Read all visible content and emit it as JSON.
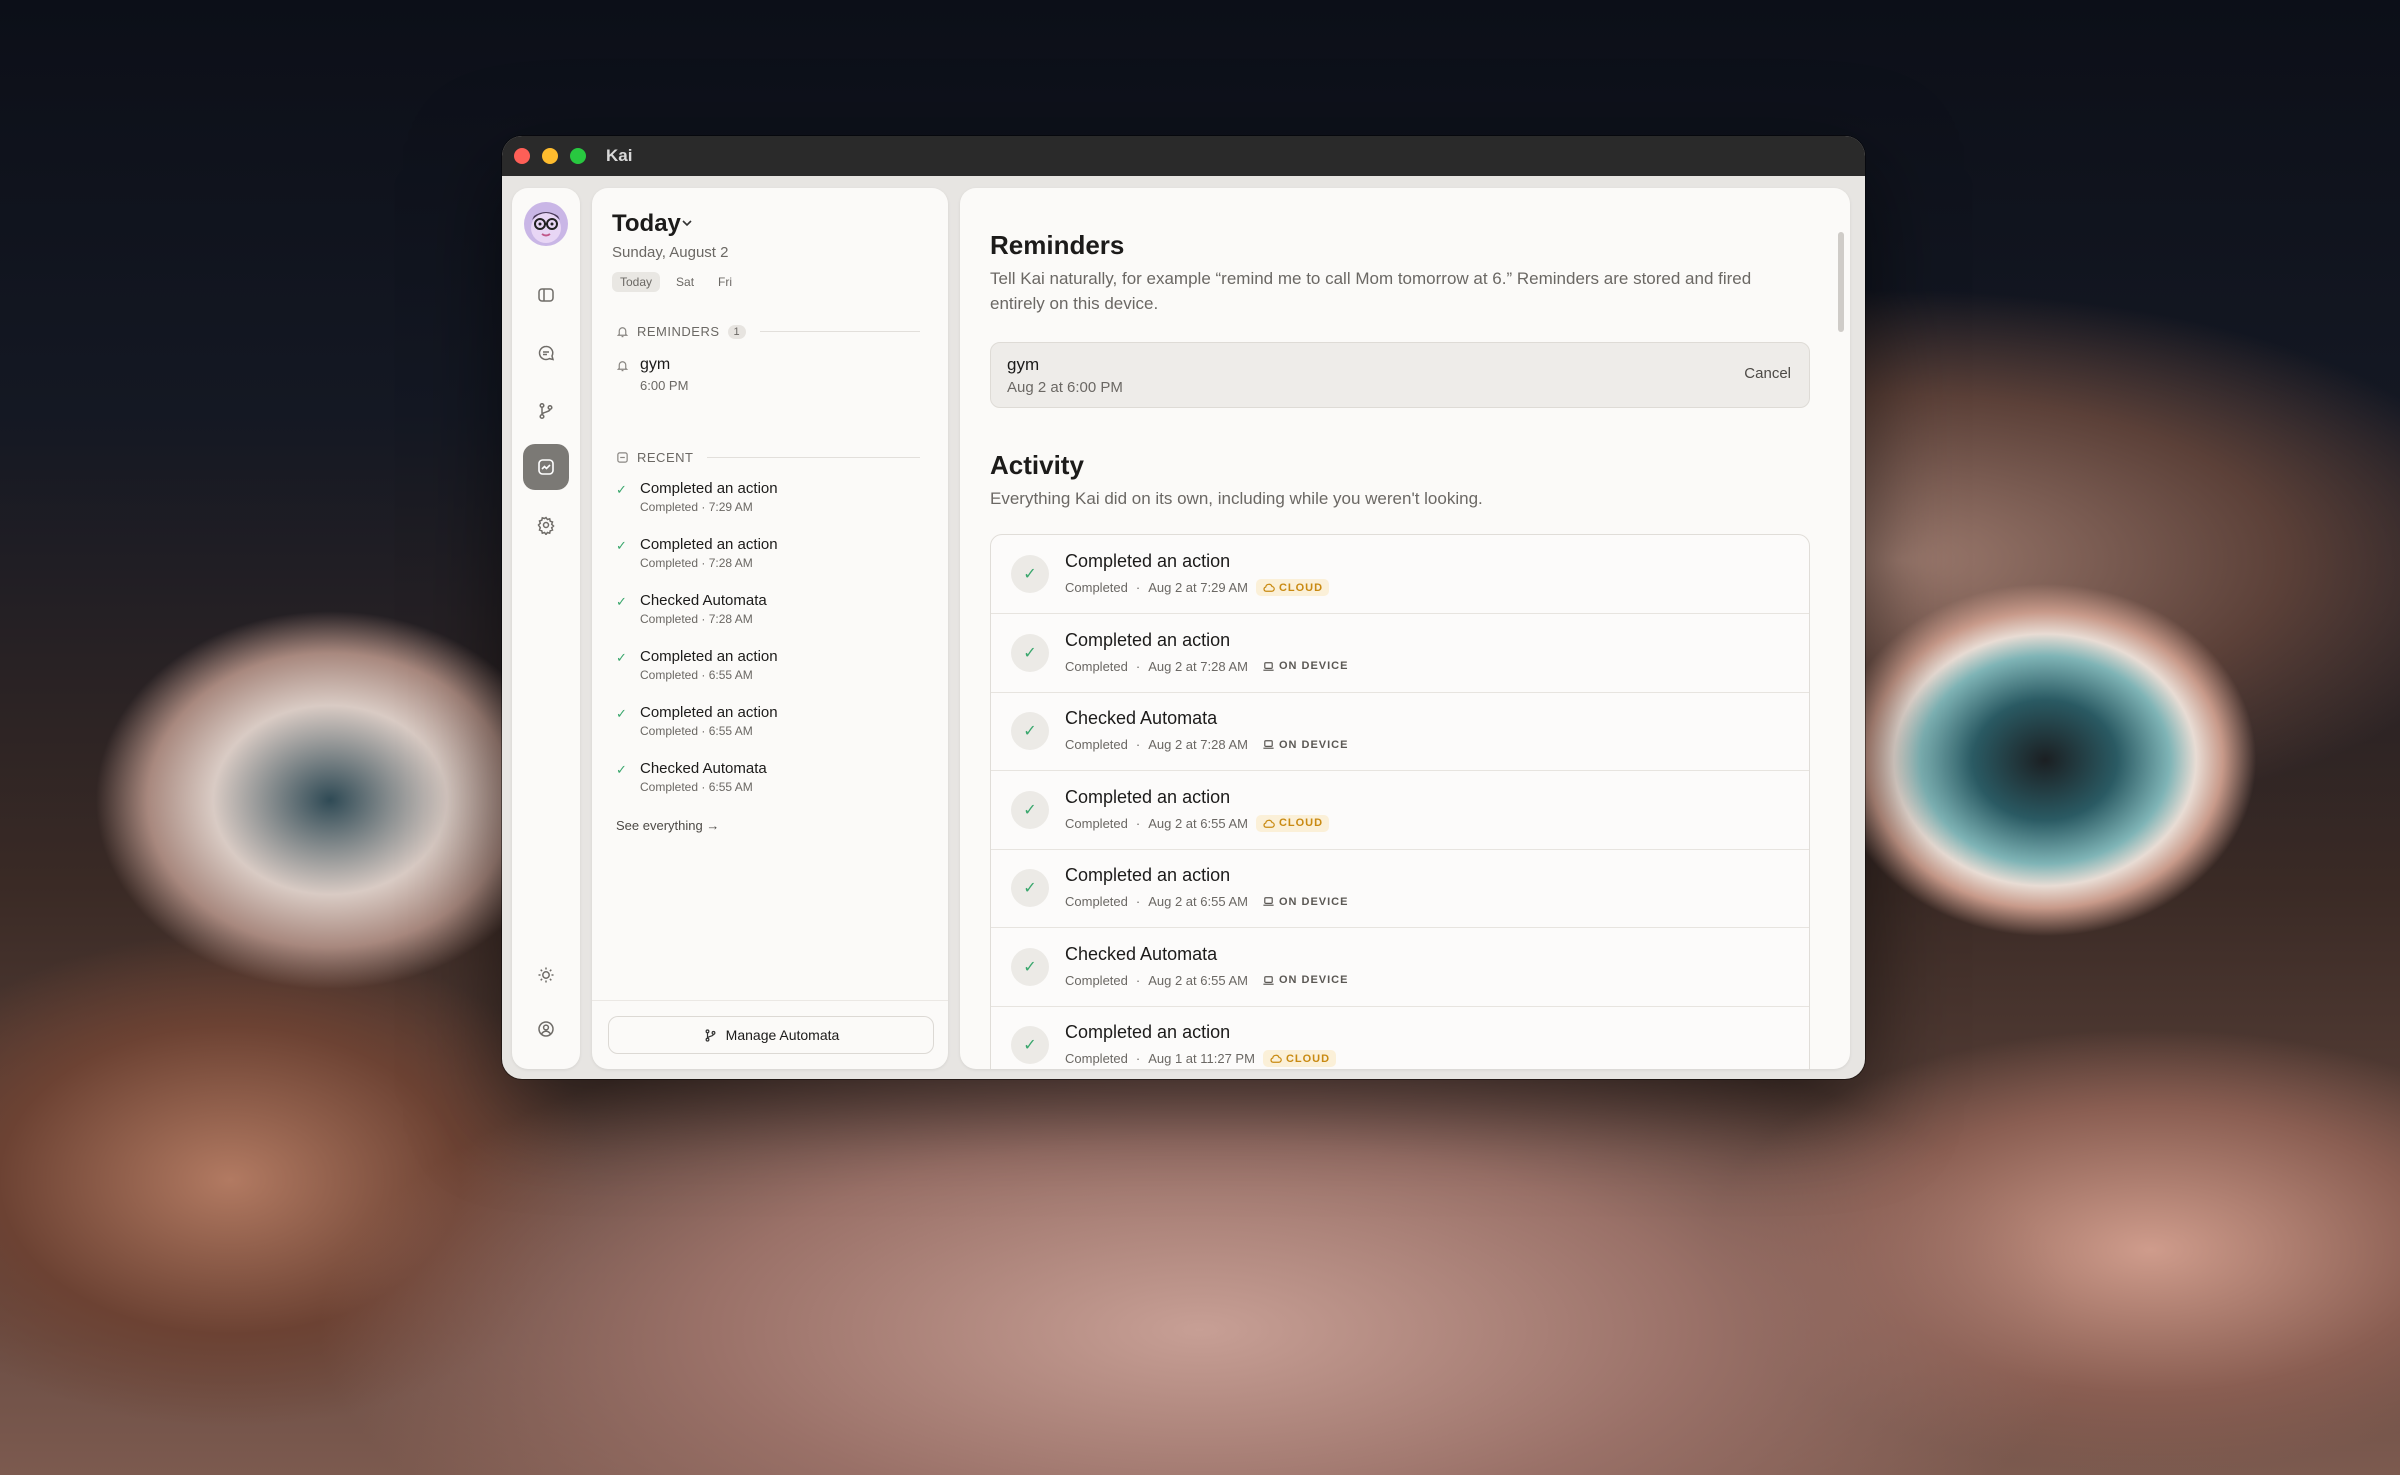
{
  "window": {
    "title": "Kai"
  },
  "rail": {
    "icons": [
      "avatar",
      "sidebar-icon",
      "chat-icon",
      "branch-icon",
      "activity-icon",
      "gear-icon",
      "sun-icon",
      "account-icon"
    ]
  },
  "sidebar": {
    "title": "Today",
    "date": "Sunday, August 2",
    "day_tabs": [
      "Today",
      "Sat",
      "Fri"
    ],
    "reminders_label": "REMINDERS",
    "reminders_count": "1",
    "reminder": {
      "name": "gym",
      "time": "6:00 PM"
    },
    "recent_label": "RECENT",
    "recent": [
      {
        "title": "Completed an action",
        "sub": "Completed · 7:29 AM"
      },
      {
        "title": "Completed an action",
        "sub": "Completed · 7:28 AM"
      },
      {
        "title": "Checked Automata",
        "sub": "Completed · 7:28 AM"
      },
      {
        "title": "Completed an action",
        "sub": "Completed · 6:55 AM"
      },
      {
        "title": "Completed an action",
        "sub": "Completed · 6:55 AM"
      },
      {
        "title": "Checked Automata",
        "sub": "Completed · 6:55 AM"
      }
    ],
    "see_all": "See everything →",
    "manage_button": "Manage Automata"
  },
  "main": {
    "reminders_title": "Reminders",
    "reminders_desc": "Tell Kai naturally, for example “remind me to call Mom tomorrow at 6.” Reminders are stored and fired entirely on this device.",
    "reminder_card": {
      "name": "gym",
      "when": "Aug 2 at 6:00 PM",
      "cancel": "Cancel"
    },
    "activity_title": "Activity",
    "activity_desc": "Everything Kai did on its own, including while you weren't looking.",
    "activity": [
      {
        "title": "Completed an action",
        "status": "Completed",
        "when": "Aug 2 at 7:29 AM",
        "tag": "CLOUD",
        "tag_type": "cloud"
      },
      {
        "title": "Completed an action",
        "status": "Completed",
        "when": "Aug 2 at 7:28 AM",
        "tag": "ON DEVICE",
        "tag_type": "device"
      },
      {
        "title": "Checked Automata",
        "status": "Completed",
        "when": "Aug 2 at 7:28 AM",
        "tag": "ON DEVICE",
        "tag_type": "device"
      },
      {
        "title": "Completed an action",
        "status": "Completed",
        "when": "Aug 2 at 6:55 AM",
        "tag": "CLOUD",
        "tag_type": "cloud"
      },
      {
        "title": "Completed an action",
        "status": "Completed",
        "when": "Aug 2 at 6:55 AM",
        "tag": "ON DEVICE",
        "tag_type": "device"
      },
      {
        "title": "Checked Automata",
        "status": "Completed",
        "when": "Aug 2 at 6:55 AM",
        "tag": "ON DEVICE",
        "tag_type": "device"
      },
      {
        "title": "Completed an action",
        "status": "Completed",
        "when": "Aug 1 at 11:27 PM",
        "tag": "CLOUD",
        "tag_type": "cloud"
      }
    ]
  },
  "colors": {
    "accent_green": "#3aa76d",
    "cloud_tag": "#c98a12",
    "active_rail": "#7b7975"
  }
}
